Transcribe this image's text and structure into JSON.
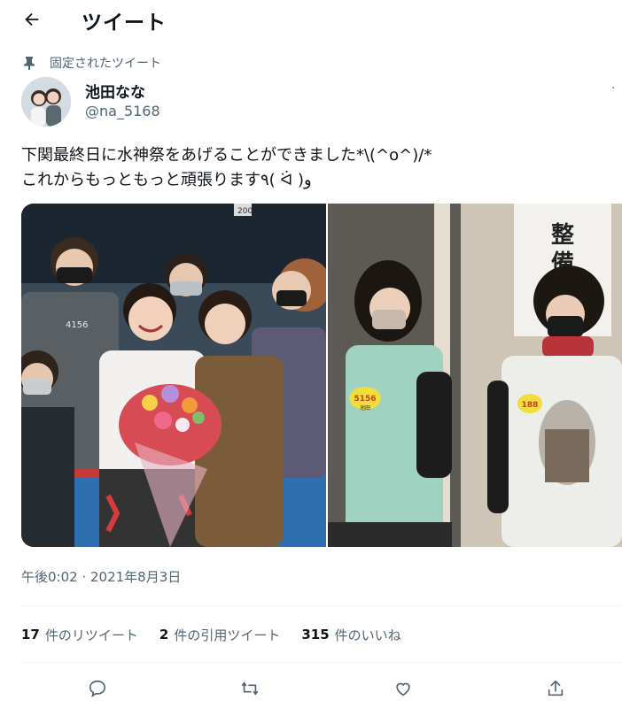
{
  "header": {
    "title": "ツイート",
    "back_icon": "arrow-left-icon"
  },
  "tweet": {
    "pinned_label": "固定されたツイート",
    "author_name": "池田なな",
    "author_handle": "@na_5168",
    "more_label": "·",
    "text": "下関最終日に水神祭をあげることができました*\\(^o^)/*\nこれからもっともっと頑張ります٩( ᐛ )و",
    "timestamp": "午後0:02 · 2021年8月3日",
    "left_photo_text": {
      "bib": "4156",
      "sign": "200"
    },
    "right_photo_text": {
      "sign": "整\n備",
      "bib_a": "5156",
      "bib_a_sub": "池田",
      "bib_b": "188"
    }
  },
  "stats": [
    {
      "count": "17",
      "label": "件のリツイート"
    },
    {
      "count": "2",
      "label": "件の引用ツイート"
    },
    {
      "count": "315",
      "label": "件のいいね"
    }
  ],
  "actions": [
    "reply-icon",
    "retweet-icon",
    "like-icon",
    "share-icon"
  ],
  "colors": {
    "text": "#0f1419",
    "secondary": "#536471",
    "divider": "#eff3f4"
  }
}
